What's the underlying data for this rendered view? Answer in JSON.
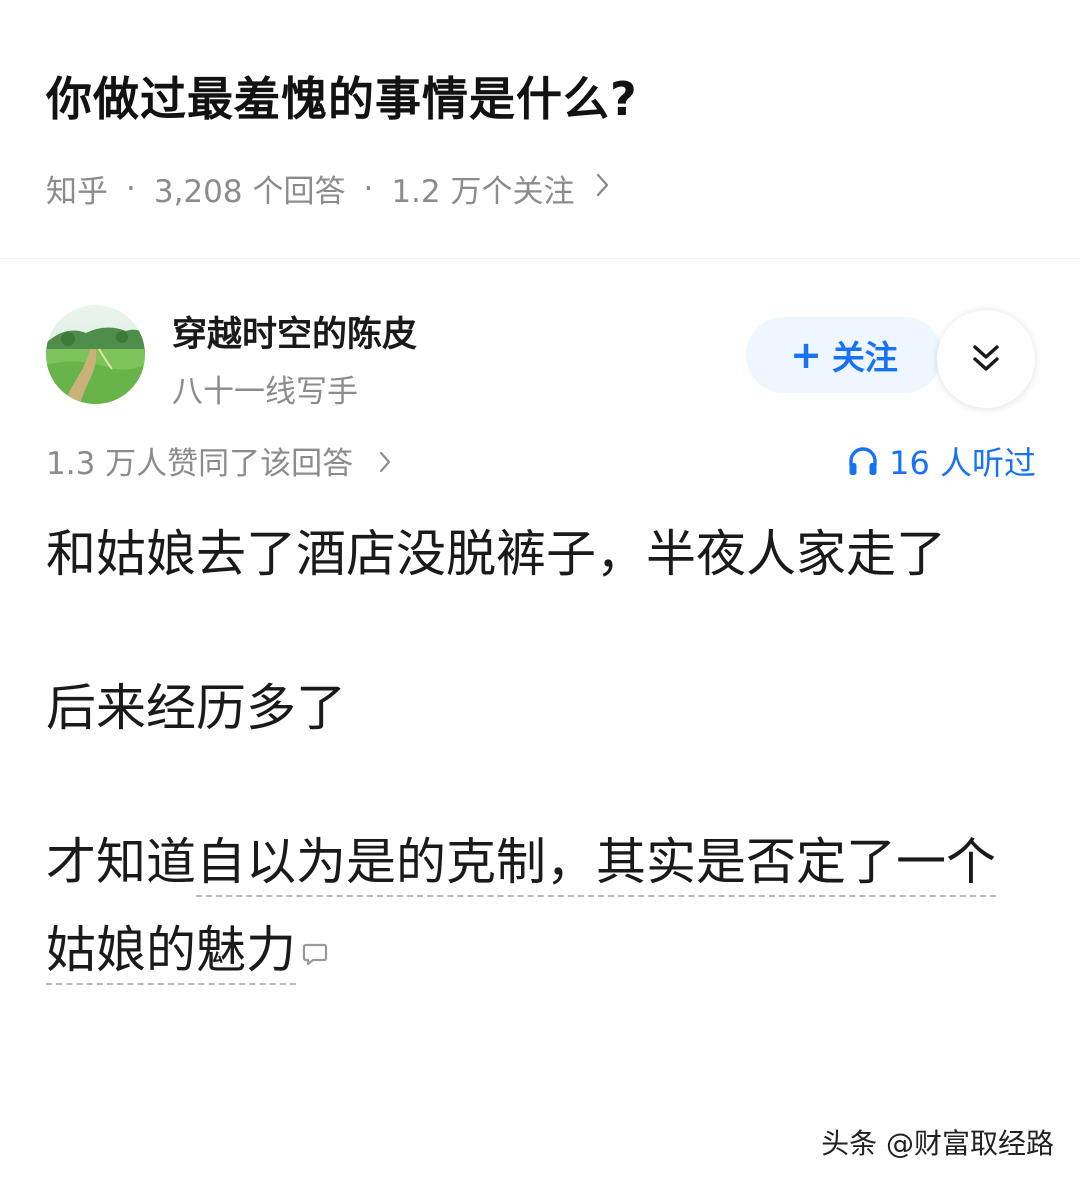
{
  "question": {
    "title": "你做过最羞愧的事情是什么?",
    "source": "知乎",
    "answer_count": "3,208 个回答",
    "follower_count": "1.2 万个关注",
    "separator": "·"
  },
  "author": {
    "name": "穿越时空的陈皮",
    "bio": "八十一线写手",
    "follow_label": "关注",
    "follow_plus": "+",
    "avatar_icon": "landscape-avatar",
    "collapse_icon": "double-chevron-down-icon"
  },
  "stats": {
    "upvotes": "1.3 万人赞同了该回答",
    "listens": "16 人听过",
    "listen_icon": "headphones-icon"
  },
  "answer": {
    "paragraph_1": "和姑娘去了酒店没脱裤子，半夜人家走了",
    "paragraph_2": "后来经历多了",
    "paragraph_3_plain": "才知道",
    "paragraph_3_highlight": "自以为是的克制，其实是否定了一个姑娘的魅力"
  },
  "watermark": "头条 @财富取经路",
  "colors": {
    "accent": "#1772f6",
    "meta_gray": "#8c8c8c",
    "follow_bg": "#eef6ff"
  }
}
